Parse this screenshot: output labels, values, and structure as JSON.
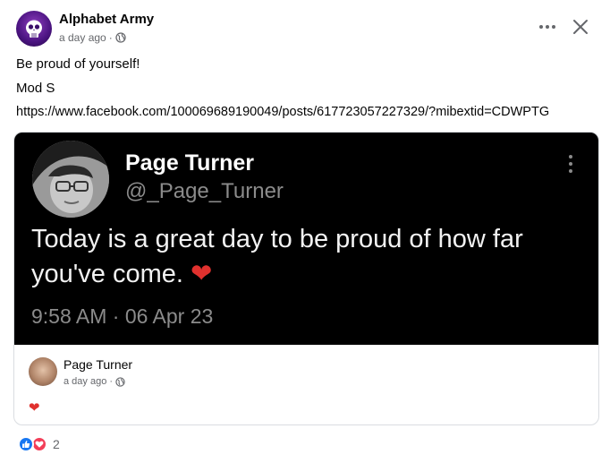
{
  "post": {
    "author": "Alphabet Army",
    "time": "a day ago",
    "dot": "·",
    "lines": [
      "Be proud of yourself!",
      "Mod S"
    ],
    "link": "https://www.facebook.com/100069689190049/posts/617723057227329/?mibextid=CDWPTG"
  },
  "tweet": {
    "name": "Page Turner",
    "handle": "@_Page_Turner",
    "text_line1": "Today is a great day to be proud of how far",
    "text_line2": "you've come.",
    "heart": "❤",
    "time": "9:58 AM · 06 Apr 23"
  },
  "shared": {
    "author": "Page Turner",
    "time": "a day ago",
    "dot": "·",
    "body": "❤"
  },
  "reactions": {
    "count": "2"
  },
  "colors": {
    "like": "#1877f2",
    "love": "#f33e58",
    "tweet_bg": "#000000"
  },
  "icons": [
    "more-icon",
    "close-icon",
    "globe-icon",
    "like-reaction-icon",
    "love-reaction-icon"
  ]
}
